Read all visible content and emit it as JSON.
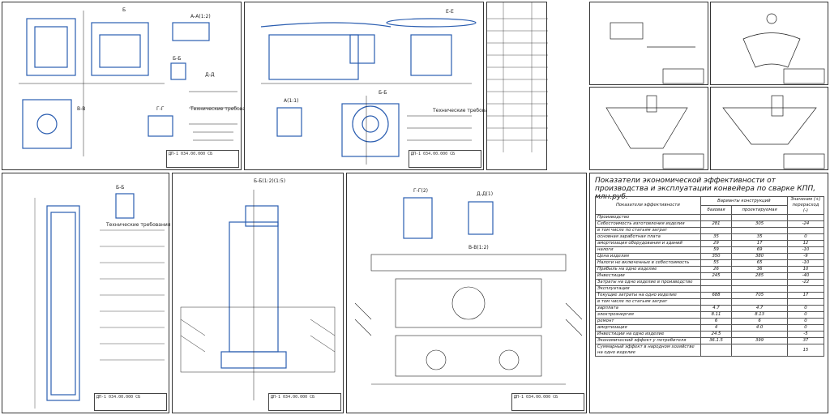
{
  "economics": {
    "title": "Показатели экономической эффективности от производства и эксплуатации конвейера по сварке КПП, млн.руб.",
    "col_indicator": "Показатели эффективности",
    "col_variants": "Варианты конструкций",
    "col_base": "базовая",
    "col_proj": "проектируемая",
    "col_sign": "Значения (+) перерасход (-)",
    "rows": [
      {
        "label": "Производство",
        "base": "",
        "proj": "",
        "diff": ""
      },
      {
        "label": "Себестоимость изготовления изделия",
        "base": "281",
        "proj": "305",
        "diff": "-24"
      },
      {
        "label": "в том числе по статьям затрат",
        "base": "",
        "proj": "",
        "diff": ""
      },
      {
        "label": "основная заработная плата",
        "base": "35",
        "proj": "35",
        "diff": "0"
      },
      {
        "label": "амортизация оборудования и зданий",
        "base": "29",
        "proj": "17",
        "diff": "12"
      },
      {
        "label": "налоги",
        "base": "59",
        "proj": "69",
        "diff": "-10"
      },
      {
        "label": "Цена изделия",
        "base": "350",
        "proj": "380",
        "diff": "-9"
      },
      {
        "label": "Налоги не включенные в себестоимость",
        "base": "55",
        "proj": "65",
        "diff": "-10"
      },
      {
        "label": "Прибыль на одно изделие",
        "base": "26",
        "proj": "36",
        "diff": "10"
      },
      {
        "label": "Инвестиции",
        "base": "245",
        "proj": "285",
        "diff": "-40"
      },
      {
        "label": "Затраты на одно изделие в производстве",
        "base": "",
        "proj": "",
        "diff": "-22"
      },
      {
        "label": "Эксплуатация",
        "base": "",
        "proj": "",
        "diff": ""
      },
      {
        "label": "Текущие затраты на одно изделие",
        "base": "688",
        "proj": "705",
        "diff": "17"
      },
      {
        "label": "в том числе по статьям затрат",
        "base": "",
        "proj": "",
        "diff": ""
      },
      {
        "label": "зарплата",
        "base": "4.7",
        "proj": "4.7",
        "diff": "0"
      },
      {
        "label": "электроэнергия",
        "base": "8.11",
        "proj": "8.13",
        "diff": "0"
      },
      {
        "label": "ремонт",
        "base": "6",
        "proj": "6",
        "diff": "0"
      },
      {
        "label": "амортизация",
        "base": "4",
        "proj": "4.0",
        "diff": "0"
      },
      {
        "label": "Инвестиции на одно изделие",
        "base": "24.5",
        "proj": "",
        "diff": "-5"
      },
      {
        "label": "Экономический эффект у потребителя",
        "base": "36.1.5",
        "proj": "399",
        "diff": "37"
      },
      {
        "label": "Суммарный эффект в народном хозяйстве на одно изделие",
        "base": "",
        "proj": "",
        "diff": "15"
      }
    ]
  },
  "sheet_labels": {
    "s1": [
      "Б",
      "А-А(1:2)",
      "Б-Б",
      "В-В",
      "Г-Г",
      "Д-Д",
      "Технические требования"
    ],
    "s2": [
      "Б-Б",
      "Е-Е",
      "А(1:1)",
      "Технические требования"
    ],
    "s3": [
      "Б-Б",
      "Б-Б(1:2)",
      "Д-Д(1)",
      "Г-Г(1)",
      "В-В(1:2)",
      "Технические требования"
    ],
    "s4": [
      "Б-Б(1:2)(1:5)",
      "Г-Г(2)",
      "Д-Д(1)",
      "В-В(1:2)"
    ],
    "stamp": "ДП-1 034.00.000 СБ"
  }
}
